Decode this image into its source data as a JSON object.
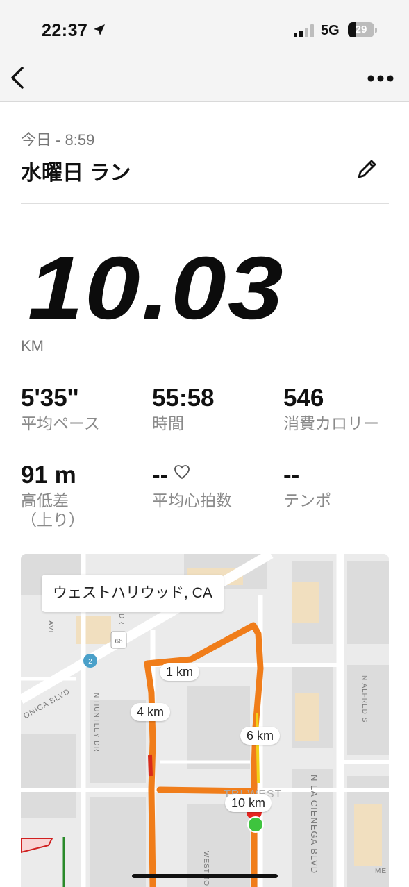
{
  "status_bar": {
    "time": "22:37",
    "network": "5G",
    "battery": "29"
  },
  "activity": {
    "date": "今日 - 8:59",
    "title": "水曜日 ラン",
    "distance": "10.03",
    "distance_unit": "KM"
  },
  "stats": [
    {
      "value": "5'35''",
      "label": "平均ペース"
    },
    {
      "value": "55:58",
      "label": "時間"
    },
    {
      "value": "546",
      "label": "消費カロリー"
    },
    {
      "value": "91 m",
      "label": "高低差\n（上り）"
    },
    {
      "value": "--",
      "label": "平均心拍数"
    },
    {
      "value": "--",
      "label": "テンポ"
    }
  ],
  "map": {
    "place": "ウェストハリウッド, CA",
    "km_markers": [
      "1 km",
      "4 km",
      "6 km",
      "10 km"
    ],
    "streets": [
      "N ALFRED ST",
      "N HUNTLEY DR",
      "ONICA BLVD",
      "N LA CIENEGA BLVD",
      "TRI WEST",
      "AVE",
      "DR",
      "ME",
      "WESTMO"
    ],
    "route_color": "#f07d1a",
    "start_color": "#3ec43e",
    "end_color": "#e52420"
  }
}
